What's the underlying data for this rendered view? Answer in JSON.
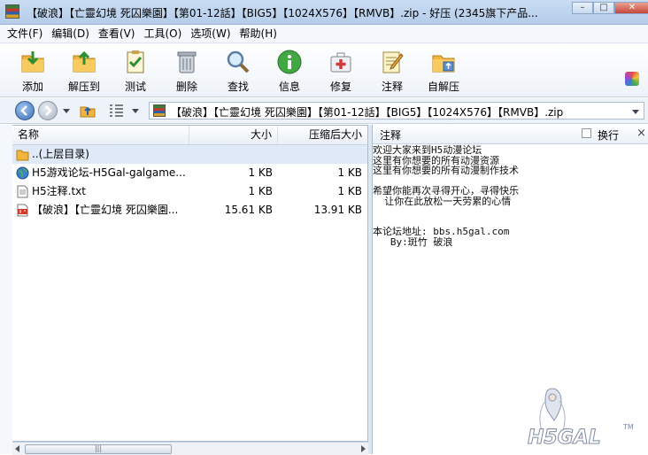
{
  "window": {
    "title": "【破浪】【亡靈幻境 死囚樂園】【第01-12話】【BIG5】【1024X576】【RMVB】.zip - 好压 (2345旗下产品..."
  },
  "window_controls": {
    "minimize": "–",
    "maximize": "□",
    "close": "✕"
  },
  "menu": [
    "文件(F)",
    "编辑(D)",
    "查看(V)",
    "工具(O)",
    "选项(W)",
    "帮助(H)"
  ],
  "toolbar": {
    "buttons": [
      {
        "label": "添加",
        "icon": "add-folder-icon"
      },
      {
        "label": "解压到",
        "icon": "extract-folder-icon"
      },
      {
        "label": "测试",
        "icon": "test-checklist-icon"
      },
      {
        "label": "删除",
        "icon": "trash-icon"
      },
      {
        "label": "查找",
        "icon": "magnifier-icon"
      },
      {
        "label": "信息",
        "icon": "info-icon"
      },
      {
        "label": "修复",
        "icon": "first-aid-kit-icon"
      },
      {
        "label": "注释",
        "icon": "note-pencil-icon"
      },
      {
        "label": "自解压",
        "icon": "self-extract-folder-icon"
      }
    ]
  },
  "address": {
    "path": "【破浪】【亡靈幻境 死囚樂園】【第01-12話】【BIG5】【1024X576】【RMVB】.zip"
  },
  "file_list": {
    "columns": {
      "name": "名称",
      "size": "大小",
      "packed": "压缩后大小"
    },
    "rows": [
      {
        "name": "..(上层目录)",
        "size": "",
        "packed": "",
        "icon": "folder-icon"
      },
      {
        "name": "H5游戏论坛-H5Gal-galgame...",
        "size": "1 KB",
        "packed": "1 KB",
        "icon": "globe-icon"
      },
      {
        "name": "H5注释.txt",
        "size": "1 KB",
        "packed": "1 KB",
        "icon": "text-file-icon"
      },
      {
        "name": "【破浪】【亡靈幻境 死囚樂園...",
        "size": "15.61 KB",
        "packed": "13.91 KB",
        "icon": "bt-file-icon"
      }
    ],
    "scroll_handle": "|||"
  },
  "comment_panel": {
    "title": "注释",
    "wrap_label": "换行",
    "close": "×",
    "lines": [
      "欢迎大家来到H5动漫论坛",
      "这里有你想要的所有动漫资源",
      "这里有你想要的所有动漫制作技术",
      "",
      "希望你能再次寻得开心，寻得快乐",
      "  让你在此放松一天劳累的心情",
      "",
      "",
      "本论坛地址: bbs.h5gal.com",
      "   By:斑竹 破浪"
    ]
  },
  "watermark": {
    "text": "H5GAL",
    "tm": "TM"
  }
}
